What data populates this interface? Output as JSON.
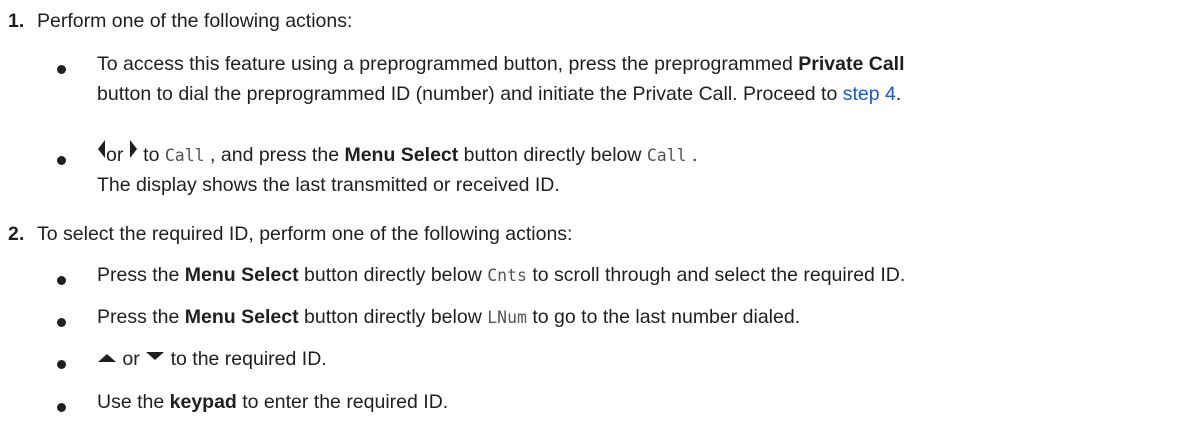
{
  "steps": [
    {
      "number": "1.",
      "text": "Perform one of the following actions:",
      "bullets": [
        {
          "line1_pre": "To access this feature using a preprogrammed button, press the preprogrammed ",
          "line1_bold": "Private Call",
          "line2_pre": "button to dial the preprogrammed ID (number) and initiate the Private Call. Proceed to ",
          "line2_link": "step 4",
          "line2_post": "."
        },
        {
          "icon_left": "left-arrow-icon",
          "mid_or": "or",
          "icon_right": "right-arrow-icon",
          "to": " to ",
          "mono1": "Call",
          "after_mono1": " , and press the ",
          "bold": "Menu Select",
          "after_bold": " button directly below ",
          "mono2": "Call",
          "end": " .",
          "line2": "The display shows the last transmitted or received ID."
        }
      ]
    },
    {
      "number": "2.",
      "text": "To select the required ID, perform one of the following actions:",
      "bullets": [
        {
          "pre": "Press the ",
          "bold": "Menu Select",
          "mid": " button directly below ",
          "mono": "Cnts",
          "post": " to scroll through and select the required ID."
        },
        {
          "pre": "Press the ",
          "bold": "Menu Select",
          "mid": " button directly below ",
          "mono": "LNum",
          "post": " to go to the last number dialed."
        },
        {
          "icon_up": "up-arrow-icon",
          "or": " or ",
          "icon_down": "down-arrow-icon",
          "post": " to the required ID."
        },
        {
          "pre": "Use the ",
          "bold": "keypad",
          "post": " to enter the required ID."
        }
      ]
    }
  ],
  "colors": {
    "text": "#1f1f1f",
    "link": "#1a56cc",
    "mono": "#555555"
  }
}
